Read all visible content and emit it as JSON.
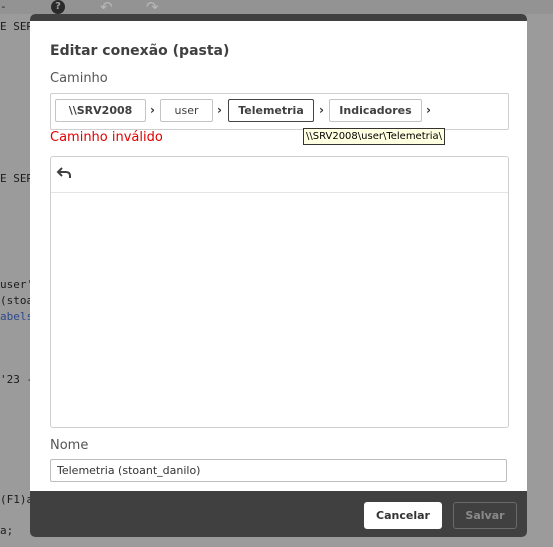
{
  "background": {
    "help_glyph": "?",
    "undo_glyph": "↶",
    "redo_glyph": "↷",
    "code_lines": [
      "-",
      "E SER",
      "E SER",
      "user'",
      "(stoa",
      "abels",
      "'23 -",
      "(F1)a",
      "a;"
    ]
  },
  "dialog": {
    "title": "Editar conexão (pasta)",
    "path_label": "Caminho",
    "breadcrumbs": [
      "\\\\SRV2008",
      "user",
      "Telemetria",
      "Indicadores"
    ],
    "separator": "›",
    "error": "Caminho inválido",
    "tooltip": "\\\\SRV2008\\user\\Telemetria\\",
    "back_icon": "back-arrow-icon",
    "name_label": "Nome",
    "name_value": "Telemetria (stoant_danilo)",
    "cancel_label": "Cancelar",
    "save_label": "Salvar"
  }
}
